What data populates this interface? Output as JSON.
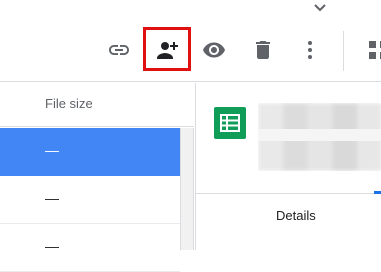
{
  "toolbar": {
    "icons": [
      "link-icon",
      "add-person-icon",
      "eye-icon",
      "trash-icon",
      "more-vert-icon",
      "grid-view-icon"
    ],
    "highlight_color": "#e01010"
  },
  "list": {
    "column_header": "File size",
    "rows": [
      {
        "size": "—",
        "selected": true
      },
      {
        "size": "—",
        "selected": false
      },
      {
        "size": "—",
        "selected": false
      }
    ],
    "selected_color": "#4285f4"
  },
  "details": {
    "file_icon": "sheets-icon",
    "tab_label": "Details",
    "icon_color": "#0f9d58"
  }
}
